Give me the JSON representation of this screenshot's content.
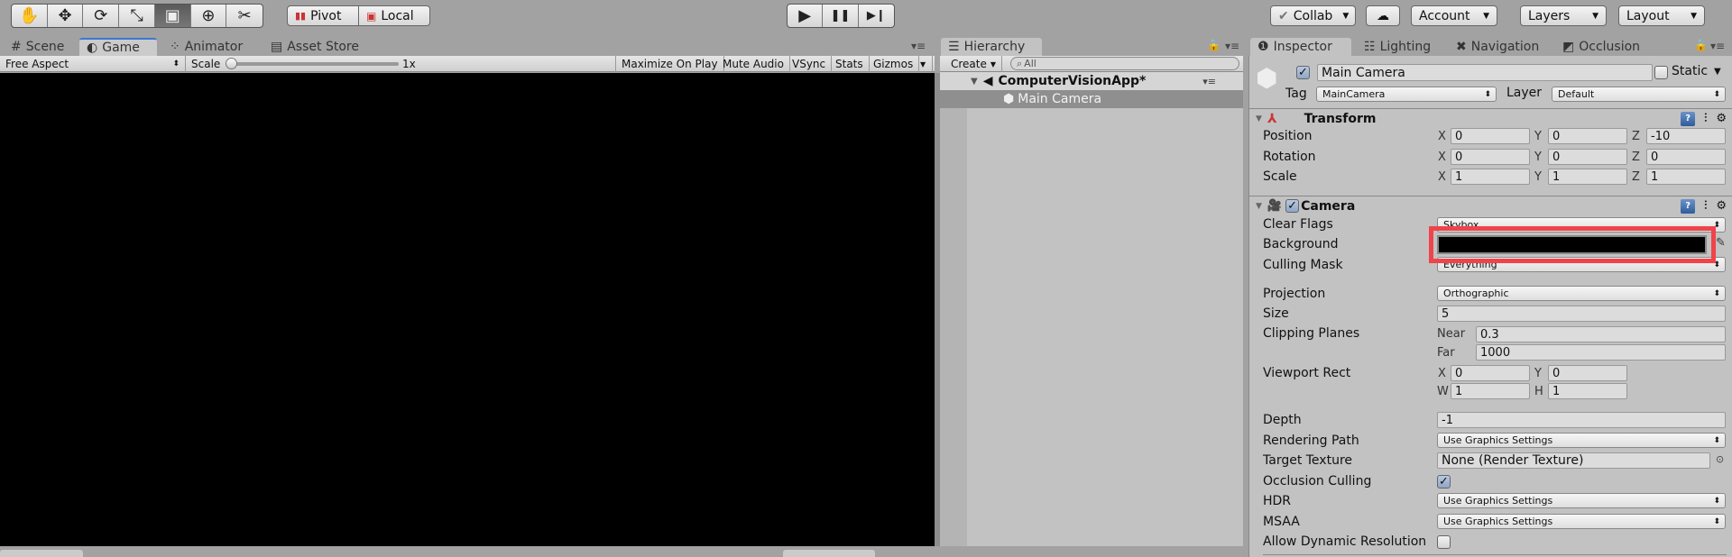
{
  "toolbar": {
    "tools": [
      {
        "name": "hand-tool",
        "glyph": "✋",
        "active": false
      },
      {
        "name": "move-tool",
        "glyph": "✥",
        "active": false
      },
      {
        "name": "rotate-tool",
        "glyph": "⟳",
        "active": false
      },
      {
        "name": "scale-tool",
        "glyph": "⤡",
        "active": false
      },
      {
        "name": "rect-tool",
        "glyph": "▣",
        "active": true
      },
      {
        "name": "transform-tool",
        "glyph": "⊕",
        "active": false
      },
      {
        "name": "custom-tool",
        "glyph": "✂",
        "active": false
      }
    ],
    "pivot_label": "Pivot",
    "local_label": "Local",
    "play_glyph": "▶",
    "pause_glyph": "❚❚",
    "step_glyph": "▶❙",
    "collab_label": "Collab",
    "cloud_glyph": "☁",
    "account_label": "Account",
    "layers_label": "Layers",
    "layout_label": "Layout"
  },
  "scene_tabs": [
    {
      "label": "Scene",
      "glyph": "#"
    },
    {
      "label": "Game",
      "glyph": "◐",
      "active": true
    },
    {
      "label": "Animator",
      "glyph": "⁘"
    },
    {
      "label": "Asset Store",
      "glyph": "▤"
    }
  ],
  "game_toolbar": {
    "aspect": "Free Aspect",
    "scale_label": "Scale",
    "scale_value_text": "1x",
    "scale_fraction": 0.0,
    "maximize_on_play": "Maximize On Play",
    "mute_audio": "Mute Audio",
    "vsync": "VSync",
    "stats": "Stats",
    "gizmos": "Gizmos"
  },
  "hierarchy": {
    "tab_label": "Hierarchy",
    "create_label": "Create",
    "search_placeholder": "All",
    "scene_name": "ComputerVisionApp*",
    "items": [
      {
        "label": "Main Camera",
        "selected": true
      }
    ]
  },
  "inspector_tabs": [
    {
      "label": "Inspector",
      "glyph": "❶",
      "active": true
    },
    {
      "label": "Lighting",
      "glyph": "☷"
    },
    {
      "label": "Navigation",
      "glyph": "✖"
    },
    {
      "label": "Occlusion",
      "glyph": "◩"
    }
  ],
  "inspector": {
    "object_name": "Main Camera",
    "active": true,
    "static_label": "Static",
    "static": false,
    "tag_label": "Tag",
    "tag_value": "MainCamera",
    "layer_label": "Layer",
    "layer_value": "Default",
    "transform": {
      "title": "Transform",
      "position_label": "Position",
      "rotation_label": "Rotation",
      "scale_label": "Scale",
      "position": {
        "x": "0",
        "y": "0",
        "z": "-10"
      },
      "rotation": {
        "x": "0",
        "y": "0",
        "z": "0"
      },
      "scale": {
        "x": "1",
        "y": "1",
        "z": "1"
      }
    },
    "camera": {
      "title": "Camera",
      "enabled": true,
      "clear_flags_label": "Clear Flags",
      "clear_flags": "Skybox",
      "background_label": "Background",
      "background_color": "#000000",
      "highlight_color": "#f0434a",
      "culling_mask_label": "Culling Mask",
      "culling_mask": "Everything",
      "projection_label": "Projection",
      "projection": "Orthographic",
      "size_label": "Size",
      "size": "5",
      "clipping_label": "Clipping Planes",
      "near_label": "Near",
      "near": "0.3",
      "far_label": "Far",
      "far": "1000",
      "viewport_label": "Viewport Rect",
      "viewport": {
        "x": "0",
        "y": "0",
        "w": "1",
        "h": "1"
      },
      "depth_label": "Depth",
      "depth": "-1",
      "rendering_path_label": "Rendering Path",
      "rendering_path": "Use Graphics Settings",
      "target_texture_label": "Target Texture",
      "target_texture": "None (Render Texture)",
      "occlusion_culling_label": "Occlusion Culling",
      "occlusion_culling": true,
      "hdr_label": "HDR",
      "hdr": "Use Graphics Settings",
      "msaa_label": "MSAA",
      "msaa": "Use Graphics Settings",
      "dynamic_res_label": "Allow Dynamic Resolution",
      "dynamic_res": false
    }
  }
}
